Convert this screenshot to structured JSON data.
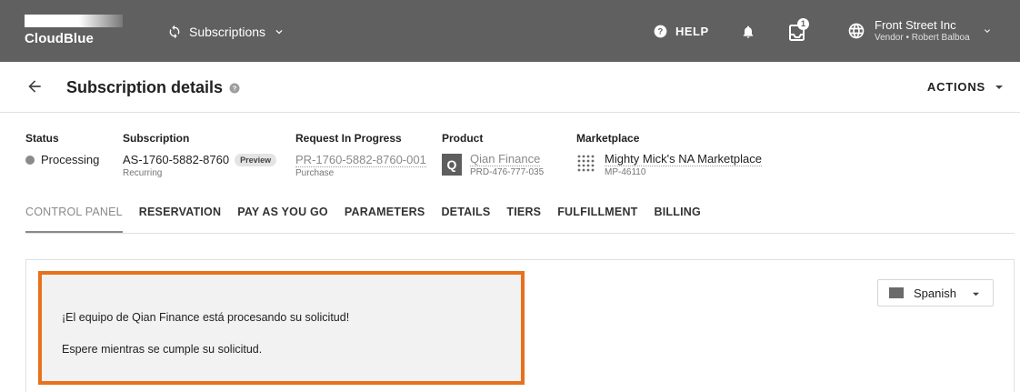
{
  "topbar": {
    "logo_text": "CloudBlue",
    "module_label": "Subscriptions",
    "help_label": "HELP",
    "notification_count": "1",
    "account_name": "Front Street Inc",
    "account_sub": "Vendor • Robert Balboa"
  },
  "header": {
    "title": "Subscription details",
    "actions_label": "ACTIONS"
  },
  "info": {
    "status": {
      "label": "Status",
      "value": "Processing"
    },
    "subscription": {
      "label": "Subscription",
      "value": "AS-1760-5882-8760",
      "chip": "Preview",
      "sub": "Recurring"
    },
    "request": {
      "label": "Request In Progress",
      "value": "PR-1760-5882-8760-001",
      "sub": "Purchase"
    },
    "product": {
      "label": "Product",
      "icon_letter": "Q",
      "value": "Qian Finance",
      "sub": "PRD-476-777-035"
    },
    "marketplace": {
      "label": "Marketplace",
      "value": "Mighty Mick's NA Marketplace",
      "sub": "MP-46110"
    }
  },
  "tabs": [
    {
      "label": "CONTROL PANEL"
    },
    {
      "label": "RESERVATION"
    },
    {
      "label": "PAY AS YOU GO"
    },
    {
      "label": "PARAMETERS"
    },
    {
      "label": "DETAILS"
    },
    {
      "label": "TIERS"
    },
    {
      "label": "FULFILLMENT"
    },
    {
      "label": "BILLING"
    }
  ],
  "message": {
    "title": "¡El equipo de Qian Finance está procesando su solicitud!",
    "body": "Espere mientras se cumple su solicitud."
  },
  "language": {
    "selected": "Spanish"
  },
  "colors": {
    "topbar": "#606060",
    "highlight_border": "#e8711c",
    "message_bg": "#f2f2f2"
  }
}
